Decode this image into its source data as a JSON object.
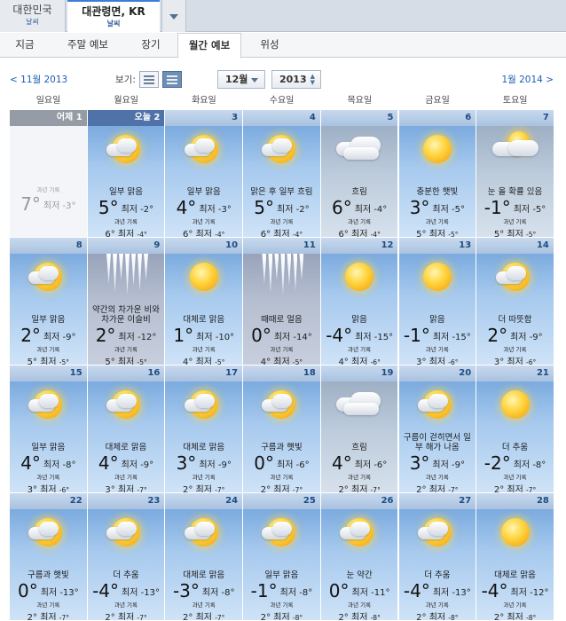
{
  "location_tabs": [
    {
      "name": "대한민국",
      "sub": "날씨"
    },
    {
      "name": "대관령면, KR",
      "sub": "날씨"
    }
  ],
  "nav_tabs": [
    "지금",
    "주말 예보",
    "장기",
    "월간 예보",
    "위성"
  ],
  "active_nav_tab": "월간 예보",
  "calendar_nav": {
    "prev": "< 11월 2013",
    "view_label": "보기:",
    "month": "12월",
    "year": "2013",
    "next": "1월 2014 >"
  },
  "weekdays": [
    "일요일",
    "월요일",
    "화요일",
    "수요일",
    "목요일",
    "금요일",
    "토요일"
  ],
  "labels": {
    "low": "최저",
    "past_avg": "과년 기록"
  },
  "colors": {
    "link": "#1d5fb4",
    "day_header": "#a9c2e0",
    "today_header": "#4f73a8",
    "sky": "#a6c9ee"
  },
  "days": [
    {
      "day": "어제 1",
      "kind": "past",
      "hi": "7°",
      "lo": "-3°"
    },
    {
      "day": "오늘 2",
      "kind": "today",
      "icon": "sun-cloud",
      "desc": "일부 맑음",
      "hi": "5°",
      "lo": "-2°",
      "avg_hi": "6°",
      "avg_lo": "-4°"
    },
    {
      "day": "3",
      "icon": "sun-cloud",
      "desc": "일부 맑음",
      "hi": "4°",
      "lo": "-3°",
      "avg_hi": "6°",
      "avg_lo": "-4°"
    },
    {
      "day": "4",
      "icon": "sun-cloud",
      "desc": "맑은 후 일부 흐림",
      "hi": "5°",
      "lo": "-2°",
      "avg_hi": "6°",
      "avg_lo": "-4°"
    },
    {
      "day": "5",
      "icon": "clouds",
      "bg": "cloud",
      "desc": "흐림",
      "hi": "6°",
      "lo": "-4°",
      "avg_hi": "6°",
      "avg_lo": "-4°"
    },
    {
      "day": "6",
      "icon": "sun",
      "desc": "충분한 햇빛",
      "hi": "3°",
      "lo": "-5°",
      "avg_hi": "5°",
      "avg_lo": "-5°"
    },
    {
      "day": "7",
      "icon": "clouds-sun",
      "bg": "cloud",
      "desc": "눈 올 확률 있음",
      "hi": "-1°",
      "lo": "-5°",
      "avg_hi": "5°",
      "avg_lo": "-5°"
    },
    {
      "day": "8",
      "icon": "sun-cloud",
      "desc": "일부 맑음",
      "hi": "2°",
      "lo": "-9°",
      "avg_hi": "5°",
      "avg_lo": "-5°"
    },
    {
      "day": "9",
      "icon": "icicles",
      "bg": "icy",
      "desc": "약간의 차가운 비와 차가운 이슬비",
      "hi": "2°",
      "lo": "-12°",
      "avg_hi": "5°",
      "avg_lo": "-5°"
    },
    {
      "day": "10",
      "icon": "sun",
      "desc": "대체로 맑음",
      "hi": "1°",
      "lo": "-10°",
      "avg_hi": "4°",
      "avg_lo": "-5°"
    },
    {
      "day": "11",
      "icon": "icicles",
      "bg": "icy",
      "desc": "때때로 얼음",
      "hi": "0°",
      "lo": "-14°",
      "avg_hi": "4°",
      "avg_lo": "-5°"
    },
    {
      "day": "12",
      "icon": "sun",
      "desc": "맑음",
      "hi": "-4°",
      "lo": "-15°",
      "avg_hi": "4°",
      "avg_lo": "-6°"
    },
    {
      "day": "13",
      "icon": "sun",
      "desc": "맑음",
      "hi": "-1°",
      "lo": "-15°",
      "avg_hi": "3°",
      "avg_lo": "-6°"
    },
    {
      "day": "14",
      "icon": "sun-cloud",
      "desc": "더 따뜻함",
      "hi": "2°",
      "lo": "-9°",
      "avg_hi": "3°",
      "avg_lo": "-6°"
    },
    {
      "day": "15",
      "icon": "sun-cloud",
      "desc": "일부 맑음",
      "hi": "4°",
      "lo": "-8°",
      "avg_hi": "3°",
      "avg_lo": "-6°"
    },
    {
      "day": "16",
      "icon": "sun-cloud",
      "desc": "대체로 맑음",
      "hi": "4°",
      "lo": "-9°",
      "avg_hi": "3°",
      "avg_lo": "-7°"
    },
    {
      "day": "17",
      "icon": "sun-cloud",
      "desc": "대체로 맑음",
      "hi": "3°",
      "lo": "-9°",
      "avg_hi": "2°",
      "avg_lo": "-7°"
    },
    {
      "day": "18",
      "icon": "sun-cloud",
      "desc": "구름과 햇빛",
      "hi": "0°",
      "lo": "-6°",
      "avg_hi": "2°",
      "avg_lo": "-7°"
    },
    {
      "day": "19",
      "icon": "clouds",
      "bg": "cloud",
      "desc": "흐림",
      "hi": "4°",
      "lo": "-6°",
      "avg_hi": "2°",
      "avg_lo": "-7°"
    },
    {
      "day": "20",
      "icon": "sun-cloud",
      "desc": "구름이 걷히면서 일부 해가 나옴",
      "hi": "3°",
      "lo": "-9°",
      "avg_hi": "2°",
      "avg_lo": "-7°"
    },
    {
      "day": "21",
      "icon": "sun",
      "desc": "더 추움",
      "hi": "-2°",
      "lo": "-8°",
      "avg_hi": "2°",
      "avg_lo": "-7°"
    },
    {
      "day": "22",
      "icon": "sun-cloud",
      "desc": "구름과 햇빛",
      "hi": "0°",
      "lo": "-13°",
      "avg_hi": "2°",
      "avg_lo": "-7°"
    },
    {
      "day": "23",
      "icon": "sun-cloud",
      "desc": "더 추움",
      "hi": "-4°",
      "lo": "-13°",
      "avg_hi": "2°",
      "avg_lo": "-7°"
    },
    {
      "day": "24",
      "icon": "sun-cloud",
      "desc": "대체로 맑음",
      "hi": "-3°",
      "lo": "-8°",
      "avg_hi": "2°",
      "avg_lo": "-7°"
    },
    {
      "day": "25",
      "icon": "sun-cloud",
      "desc": "일부 맑음",
      "hi": "-1°",
      "lo": "-8°",
      "avg_hi": "2°",
      "avg_lo": "-8°"
    },
    {
      "day": "26",
      "icon": "sun-cloud",
      "desc": "눈 약간",
      "hi": "0°",
      "lo": "-11°",
      "avg_hi": "2°",
      "avg_lo": "-8°"
    },
    {
      "day": "27",
      "icon": "sun-cloud",
      "desc": "더 추움",
      "hi": "-4°",
      "lo": "-13°",
      "avg_hi": "2°",
      "avg_lo": "-8°"
    },
    {
      "day": "28",
      "icon": "sun",
      "desc": "대체로 맑음",
      "hi": "-4°",
      "lo": "-12°",
      "avg_hi": "2°",
      "avg_lo": "-8°"
    }
  ]
}
